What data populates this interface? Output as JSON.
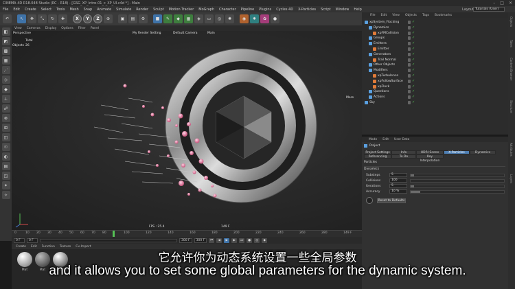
{
  "window": {
    "title": "CINEMA 4D R18.048 Studio (RC - R18) - [GSG_XP_Intro-01_c_XP_UI.c4d *] - Main"
  },
  "menubar": {
    "items": [
      "File",
      "Edit",
      "Create",
      "Select",
      "Tools",
      "Mesh",
      "Snap",
      "Animate",
      "Simulate",
      "Render",
      "Sculpt",
      "Motion Tracker",
      "MoGraph",
      "Character",
      "Pipeline",
      "Plugins",
      "Cycles 4D",
      "X-Particles",
      "Script",
      "Window",
      "Help"
    ]
  },
  "layout": {
    "label": "Layout:",
    "value": "Tutorials (User)"
  },
  "toolbar": {
    "axis_x": "X",
    "axis_y": "Y",
    "axis_z": "Z"
  },
  "viewport": {
    "menu": [
      "View",
      "Cameras",
      "Display",
      "Options",
      "Filter",
      "Panel"
    ],
    "view_name": "Perspective",
    "render_setting": "My Render Setting",
    "camera": "Default Camera",
    "main_label": "Main",
    "total_label": "Total",
    "objects_label": "Objects",
    "objects_count": "26",
    "more_label": "More",
    "fps": "FPS : 25.4",
    "frame": "149 F"
  },
  "timeline": {
    "ticks": [
      "0",
      "10",
      "20",
      "30",
      "40",
      "50",
      "60",
      "70",
      "80",
      "90",
      "100",
      "110",
      "120",
      "130",
      "140",
      "150",
      "160",
      "170",
      "180",
      "190",
      "200",
      "210",
      "220",
      "230",
      "240",
      "250",
      "260",
      "270",
      "280",
      "290",
      "300",
      "310"
    ],
    "end_frame": "149 F",
    "start_field": "0 F",
    "current_field": "0 F",
    "range_field": "300 F",
    "max_field": "300 F"
  },
  "material_manager": {
    "menu": [
      "Create",
      "Edit",
      "Function",
      "Texture",
      "Cv-Import"
    ],
    "materials": [
      {
        "name": "Mat",
        "color": "#d9d9d9"
      },
      {
        "name": "Mat",
        "color": "#7a7a7a"
      },
      {
        "name": "Metal 09",
        "color": "#b8b8b8"
      }
    ]
  },
  "object_manager": {
    "menu": [
      "File",
      "Edit",
      "View",
      "Objects",
      "Tags",
      "Bookmarks"
    ],
    "rows": [
      {
        "label": "xpSystem_Flocking",
        "indent": 0,
        "color": "#5aa0e0"
      },
      {
        "label": "Dynamics",
        "indent": 1,
        "color": "#5aa0e0"
      },
      {
        "label": "xpFMCollision",
        "indent": 2,
        "color": "#e07b39"
      },
      {
        "label": "Groups",
        "indent": 1,
        "color": "#5aa0e0"
      },
      {
        "label": "Emitters",
        "indent": 1,
        "color": "#5aa0e0"
      },
      {
        "label": "Emitter",
        "indent": 2,
        "color": "#e07b39"
      },
      {
        "label": "Generators",
        "indent": 1,
        "color": "#5aa0e0"
      },
      {
        "label": "Trail Normal",
        "indent": 2,
        "color": "#e07b39"
      },
      {
        "label": "Other Objects",
        "indent": 1,
        "color": "#5aa0e0"
      },
      {
        "label": "Modifiers",
        "indent": 1,
        "color": "#5aa0e0"
      },
      {
        "label": "xpTurbulence",
        "indent": 2,
        "color": "#e07b39"
      },
      {
        "label": "xpFollowSurface",
        "indent": 2,
        "color": "#e07b39"
      },
      {
        "label": "xpFlock",
        "indent": 2,
        "color": "#e07b39"
      },
      {
        "label": "Questions",
        "indent": 1,
        "color": "#5aa0e0"
      },
      {
        "label": "Actions",
        "indent": 1,
        "color": "#5aa0e0"
      },
      {
        "label": "Sky",
        "indent": 0,
        "color": "#5aa0e0"
      }
    ]
  },
  "attribute_manager": {
    "menu": [
      "Mode",
      "Edit",
      "User Data"
    ],
    "object_name": "Project",
    "tabs_row1": [
      "Project Settings",
      "Info",
      "HDRI Scene Mesh",
      "X-Particles",
      "Dynamics"
    ],
    "tabs_row2": [
      "Referencing",
      "To Do",
      "Key Interpolation"
    ],
    "active_tab": "X-Particles",
    "section_particles": "Particles",
    "section_dynamics": "Dynamics",
    "params": [
      {
        "label": "Substeps",
        "value": "5",
        "fill": 0.04
      },
      {
        "label": "Collisions",
        "value": "100",
        "fill": 0.0
      },
      {
        "label": "Iterations",
        "value": "5",
        "fill": 0.04
      },
      {
        "label": "Accuracy",
        "value": "10 %",
        "fill": 0.1
      }
    ],
    "reset_button": "Reset to Defaults"
  },
  "right_strip": {
    "labels": [
      "Objects",
      "Takes",
      "Content Browser",
      "Structure",
      "Attributes",
      "Layers"
    ]
  },
  "subtitles": {
    "chinese": "它允许你为动态系统设置一些全局参数",
    "english": "and it allows you to set some global parameters for the dynamic system."
  }
}
